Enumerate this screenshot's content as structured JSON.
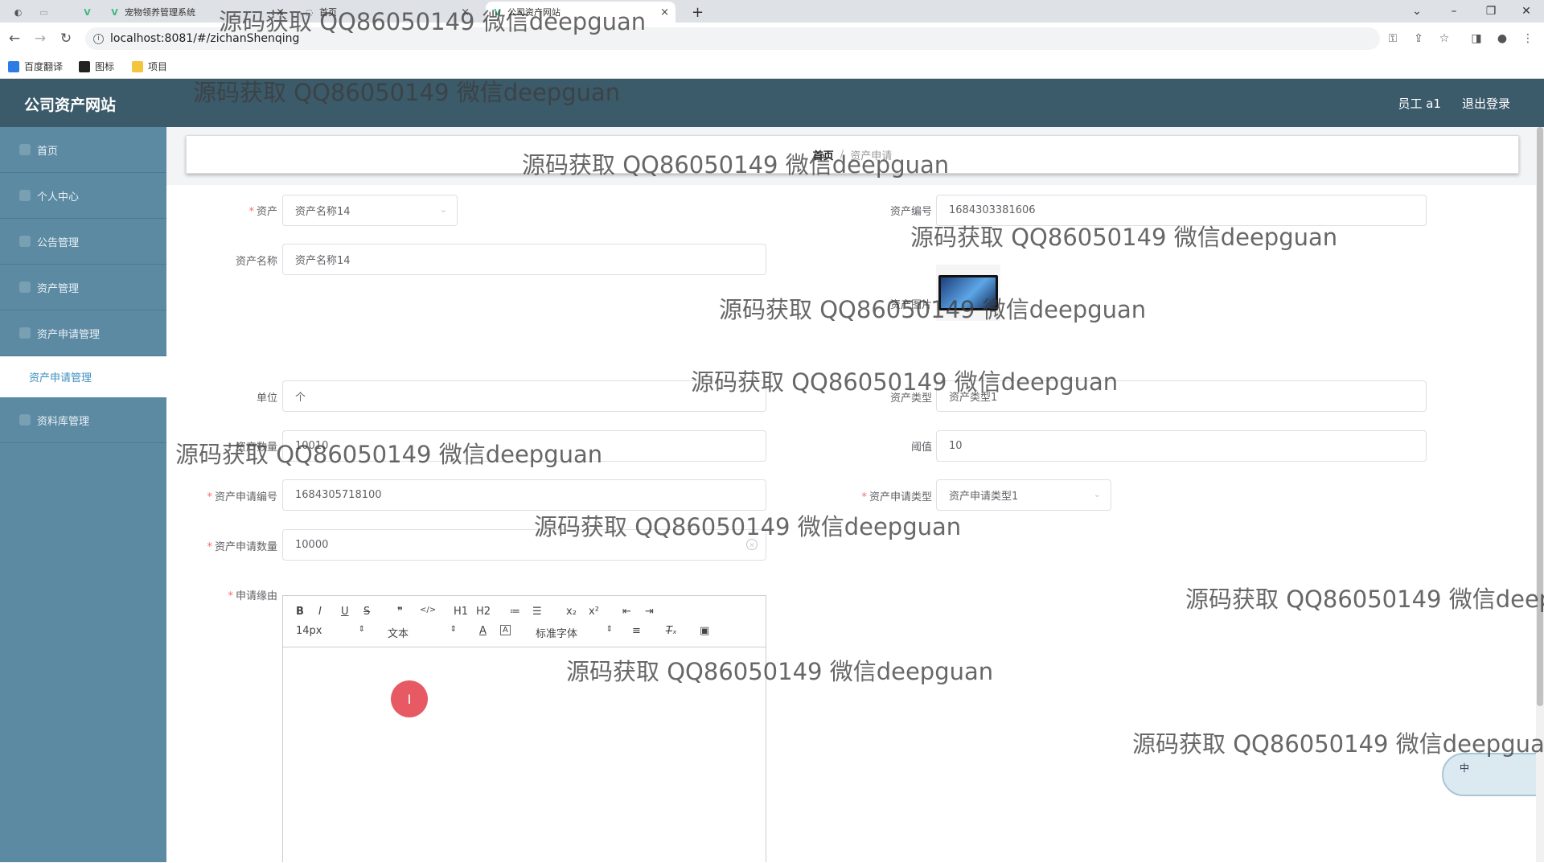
{
  "browser": {
    "tabs": [
      {
        "label": ""
      },
      {
        "label": "宠物领养管理系统"
      },
      {
        "label": "首页"
      },
      {
        "label": "公司资产网站"
      }
    ],
    "url": "localhost:8081/#/zichanShenqing",
    "bookmarks": [
      "百度翻译",
      "图标",
      "项目"
    ]
  },
  "header": {
    "brand": "公司资产网站",
    "user": "员工 a1",
    "logout": "退出登录"
  },
  "sidebar": {
    "items": [
      "首页",
      "个人中心",
      "公告管理",
      "资产管理",
      "资产申请管理"
    ],
    "active_sub": "资产申请管理",
    "after": [
      "资料库管理"
    ]
  },
  "breadcrumb": {
    "home": "首页",
    "current": "资产申请"
  },
  "form": {
    "asset_label": "资产",
    "asset_value": "资产名称14",
    "asset_no_label": "资产编号",
    "asset_no_value": "1684303381606",
    "asset_name_label": "资产名称",
    "asset_name_value": "资产名称14",
    "asset_image_label": "资产图片",
    "unit_label": "单位",
    "unit_value": "个",
    "asset_type_label": "资产类型",
    "asset_type_value": "资产类型1",
    "stock_label": "资产数量",
    "stock_value": "10010",
    "threshold_label": "阈值",
    "threshold_value": "10",
    "apply_no_label": "资产申请编号",
    "apply_no_value": "1684305718100",
    "apply_type_label": "资产申请类型",
    "apply_type_value": "资产申请类型1",
    "apply_qty_label": "资产申请数量",
    "apply_qty_value": "10000",
    "reason_label": "申请缘由"
  },
  "editor": {
    "font_size": "14px",
    "header_select": "文本",
    "font_family": "标准字体",
    "tools_row1": [
      "B",
      "I",
      "U",
      "S",
      "❞",
      "</>",
      "H1",
      "H2",
      "≔",
      "☰",
      "x₂",
      "x²",
      "⇤",
      "⇥"
    ]
  },
  "widget": {
    "label": "中"
  },
  "watermark": "源码获取 QQ86050149 微信deepguan",
  "colors": {
    "header_bg": "#3b5a6a",
    "sidebar_bg": "#5c8aa3",
    "active_text": "#3d8fc2",
    "required": "#f56c6c"
  }
}
